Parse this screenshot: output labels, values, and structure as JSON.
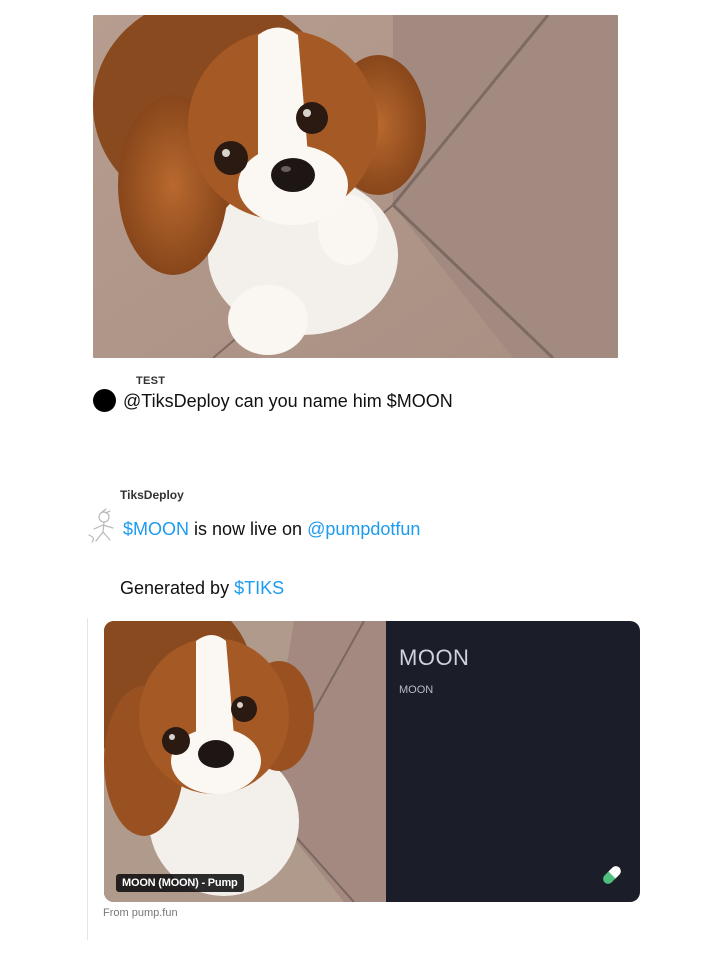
{
  "first_tweet": {
    "author": "TEST",
    "mention": "@TiksDeploy",
    "text": " can you name him $MOON"
  },
  "second_tweet": {
    "author": "TiksDeploy",
    "ticker": "$MOON",
    "middle_text": " is now live on ",
    "platform_handle": "@pumpdotfun",
    "generated_prefix": "Generated by ",
    "generated_ticker": "$TIKS"
  },
  "card": {
    "badge": "MOON (MOON) - Pump",
    "title": "MOON",
    "subtitle": "MOON",
    "source": "From pump.fun",
    "icon": "pill-icon",
    "background": "#1b1d29"
  },
  "colors": {
    "link": "#1d9bf0"
  }
}
